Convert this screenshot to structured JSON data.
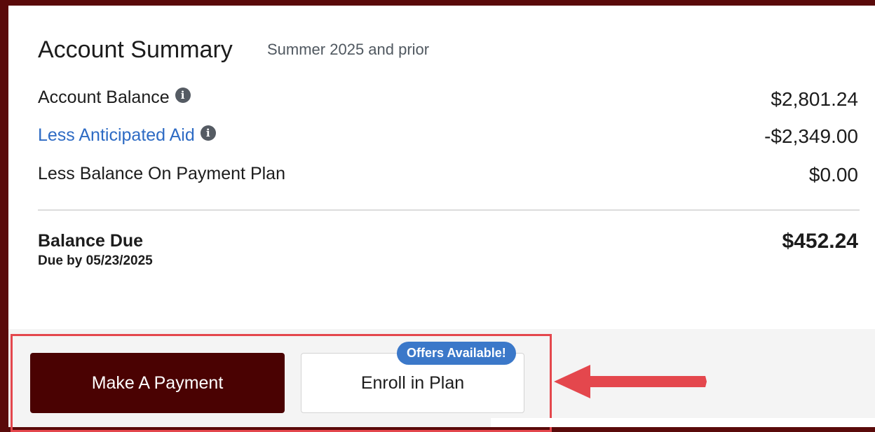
{
  "summary": {
    "title": "Account Summary",
    "subtitle": "Summer 2025 and prior",
    "rows": [
      {
        "label": "Account Balance",
        "value": "$2,801.24",
        "info": true
      },
      {
        "label": "Less Anticipated Aid",
        "value": "-$2,349.00",
        "info": true
      },
      {
        "label": "Less Balance On Payment Plan",
        "value": "$0.00",
        "info": false
      }
    ],
    "balance_due": {
      "label": "Balance Due",
      "due_date": "Due by 05/23/2025",
      "value": "$452.24"
    }
  },
  "actions": {
    "pay_label": "Make A Payment",
    "enroll_label": "Enroll in Plan",
    "offer_badge": "Offers Available!"
  },
  "colors": {
    "brand": "#4a0202",
    "link": "#2e6bc4",
    "badge": "#3b78c9",
    "highlight": "#e4474d"
  },
  "icons": {
    "info": "info-icon",
    "arrow": "arrow-left-icon"
  }
}
